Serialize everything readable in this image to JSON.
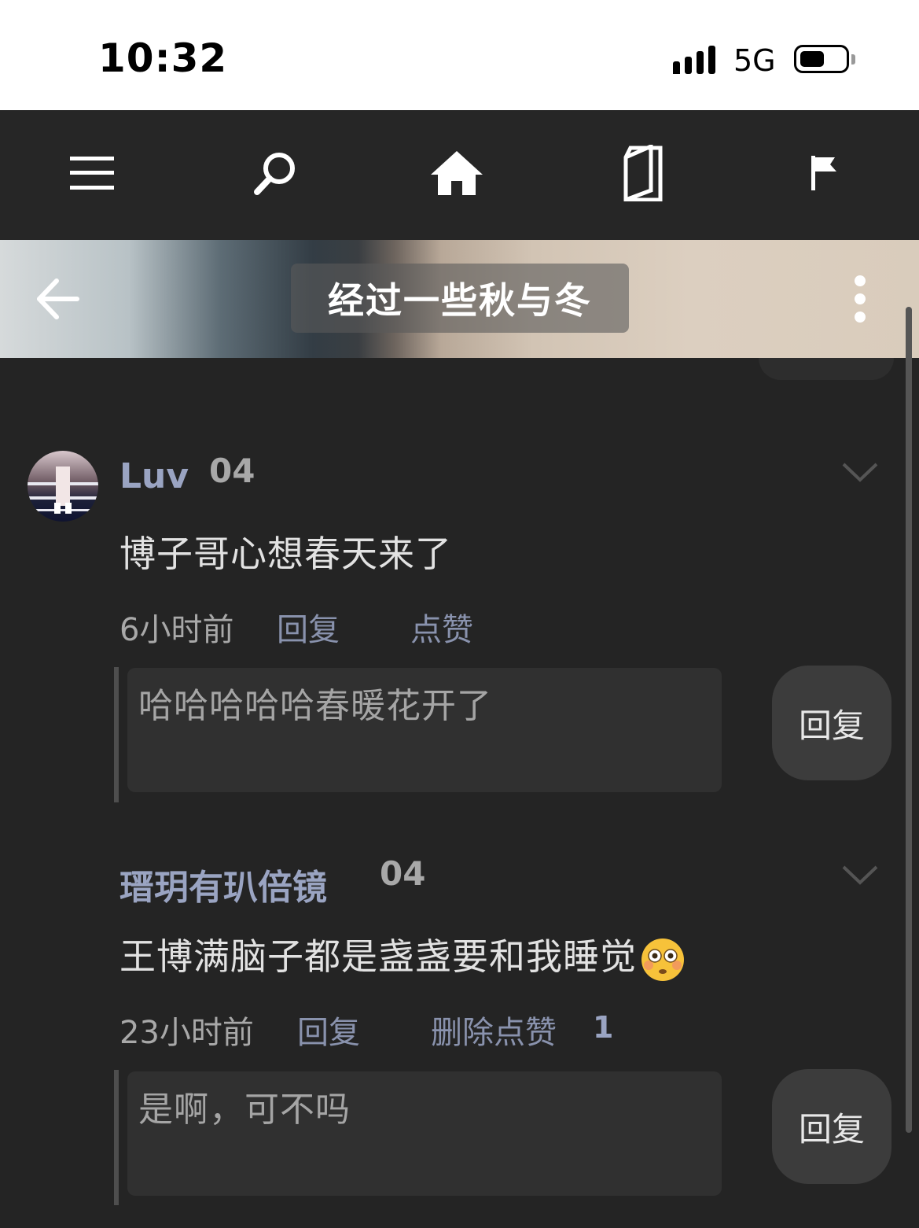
{
  "status_bar": {
    "time": "10:32",
    "network": "5G",
    "battery_level": 0.55
  },
  "nav": {
    "icons": [
      "menu-icon",
      "search-icon",
      "home-icon",
      "book-icon",
      "flag-icon"
    ]
  },
  "header": {
    "title": "经过一些秋与冬"
  },
  "comments": [
    {
      "username": "Luv",
      "badge": "04",
      "text": "博子哥心想春天来了",
      "time": "6小时前",
      "reply_label": "回复",
      "like_label": "点赞",
      "reply_input_value": "哈哈哈哈哈春暖花开了",
      "reply_button": "回复"
    },
    {
      "username": "瑨玥有玐倍镜",
      "badge": "04",
      "text": "王博满脑子都是盏盏要和我睡觉",
      "emoji": "flushed-face-emoji",
      "time": "23小时前",
      "reply_label": "回复",
      "like_label": "删除点赞",
      "like_count": "1",
      "reply_input_value": "是啊，可不吗",
      "reply_button": "回复"
    }
  ]
}
